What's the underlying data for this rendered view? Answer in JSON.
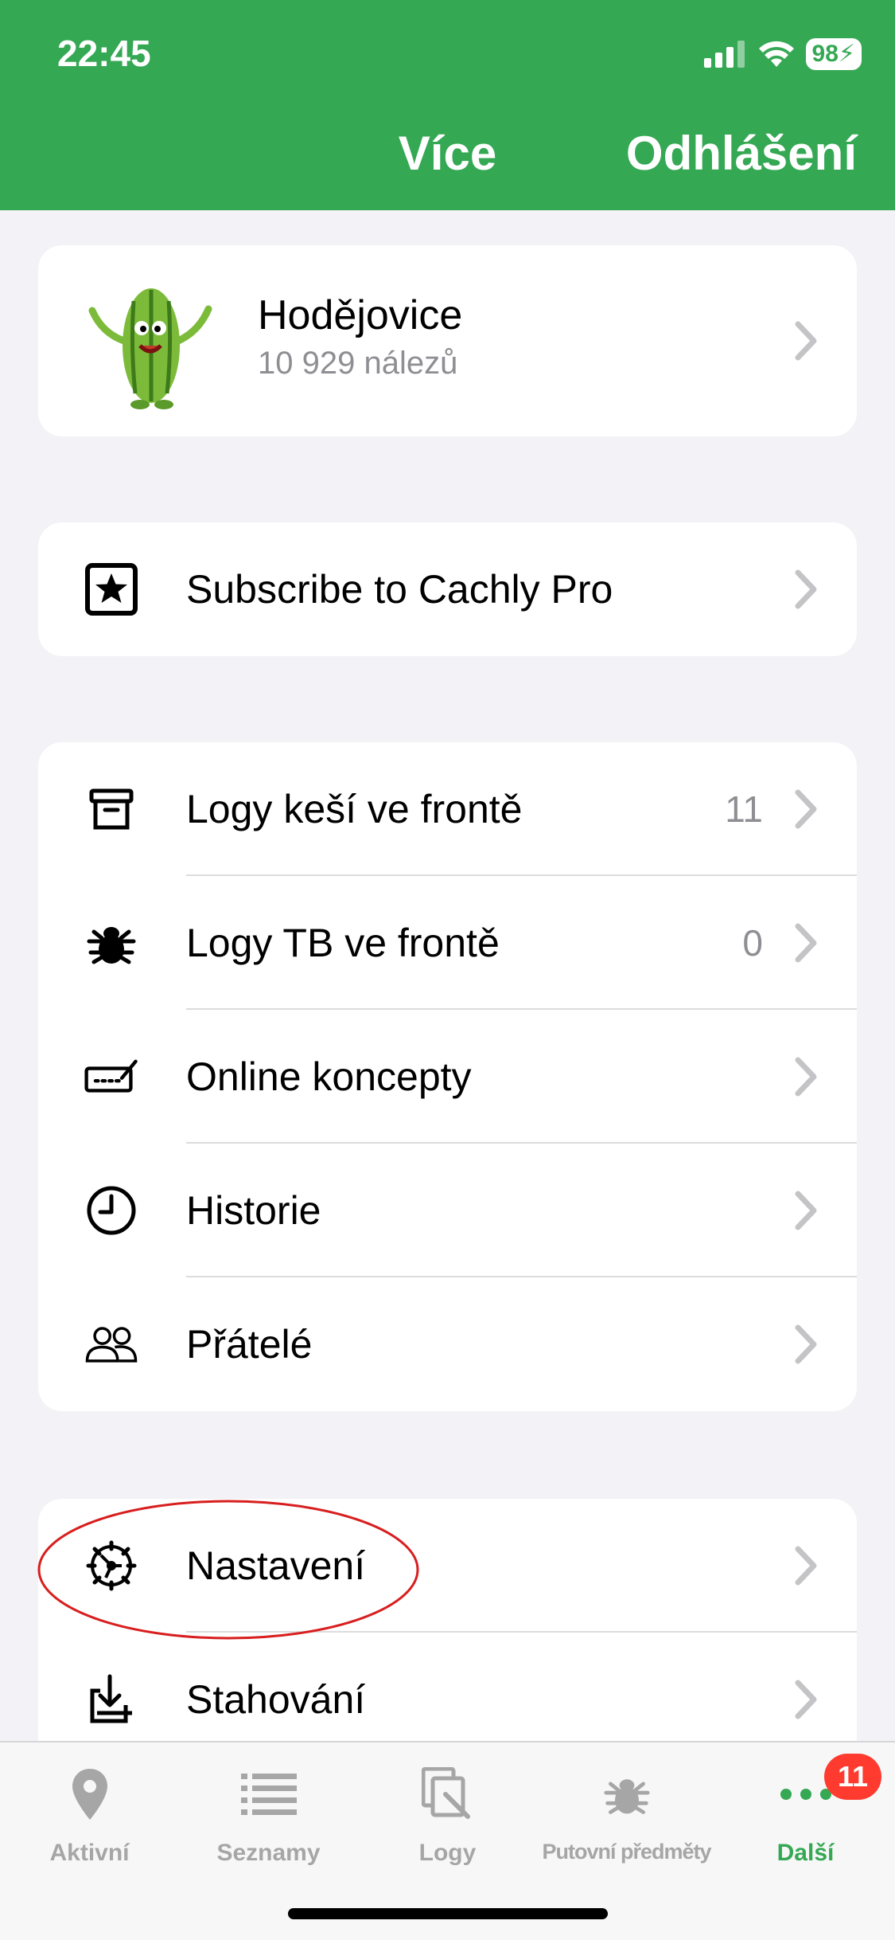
{
  "status": {
    "time": "22:45",
    "battery": "98"
  },
  "nav": {
    "title": "Více",
    "logout": "Odhlášení"
  },
  "profile": {
    "name": "Hodějovice",
    "finds": "10 929 nálezů"
  },
  "subscribe": {
    "label": "Subscribe to Cachly Pro"
  },
  "menu": [
    {
      "label": "Logy keší ve frontě",
      "count": "11",
      "icon": "archive-box-icon"
    },
    {
      "label": "Logy TB ve frontě",
      "count": "0",
      "icon": "bug-icon"
    },
    {
      "label": "Online koncepty",
      "count": "",
      "icon": "signature-icon"
    },
    {
      "label": "Historie",
      "count": "",
      "icon": "clock-icon"
    },
    {
      "label": "Přátelé",
      "count": "",
      "icon": "people-icon"
    }
  ],
  "settings": [
    {
      "label": "Nastavení",
      "icon": "gear-icon"
    },
    {
      "label": "Stahování",
      "icon": "download-icon"
    }
  ],
  "tabs": [
    {
      "label": "Aktivní",
      "icon": "map-pin-icon"
    },
    {
      "label": "Seznamy",
      "icon": "list-icon"
    },
    {
      "label": "Logy",
      "icon": "logs-icon"
    },
    {
      "label": "Putovní předměty",
      "icon": "trackable-icon"
    },
    {
      "label": "Další",
      "icon": "more-dots-icon",
      "badge": "11"
    }
  ],
  "colors": {
    "accent": "#35a854",
    "badge": "#ff3b30",
    "annotation": "#d81e1e"
  }
}
